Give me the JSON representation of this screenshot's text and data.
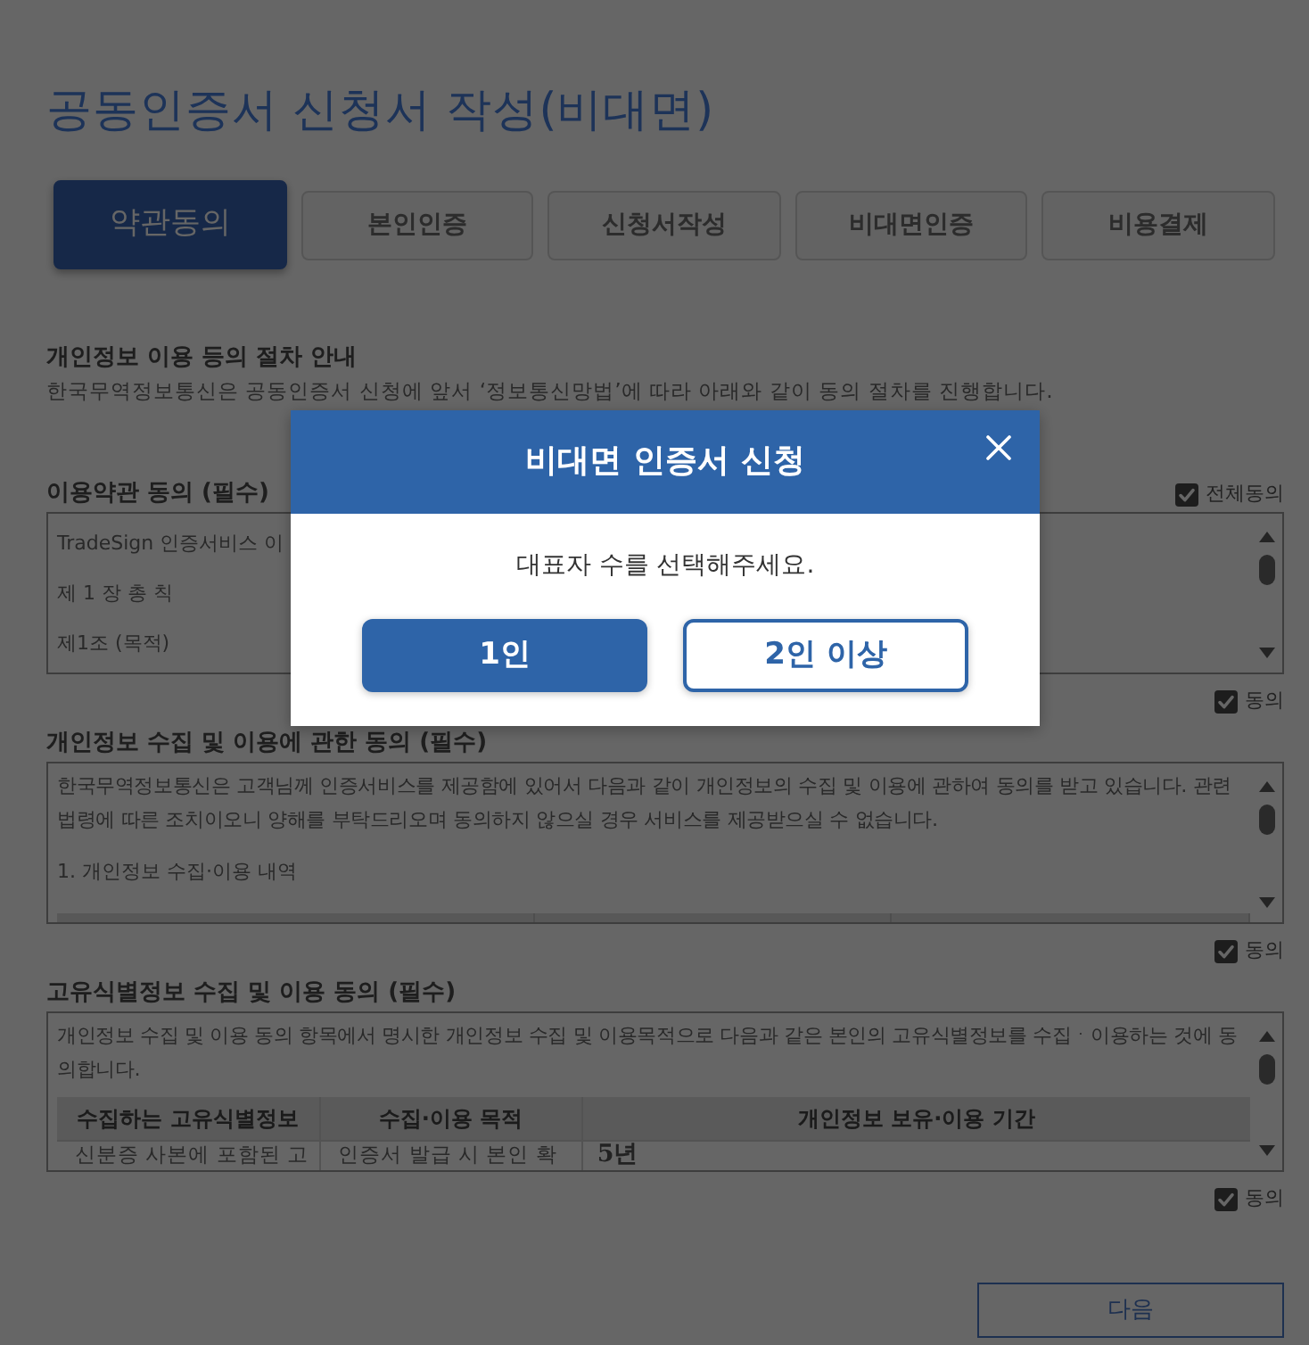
{
  "page": {
    "title": "공동인증서 신청서 작성(비대면)"
  },
  "steps": [
    {
      "label": "약관동의",
      "selected": true
    },
    {
      "label": "본인인증",
      "selected": false
    },
    {
      "label": "신청서작성",
      "selected": false
    },
    {
      "label": "비대면인증",
      "selected": false
    },
    {
      "label": "비용결제",
      "selected": false
    }
  ],
  "notice": {
    "heading": "개인정보 이용 등의 절차 안내",
    "text": "한국무역정보통신은 공동인증서 신청에 앞서 ‘정보통신망법’에 따라 아래와 같이 동의 절차를 진행합니다."
  },
  "agree_all": {
    "label": "전체동의",
    "checked": true
  },
  "sections": [
    {
      "heading": "이용약관 동의 (필수)",
      "content": [
        {
          "kind": "line",
          "text": "TradeSign 인증서비스 이"
        },
        {
          "kind": "line",
          "text": "제 1 장 총 칙"
        },
        {
          "kind": "line",
          "text": "제1조 (목적)"
        }
      ],
      "agree": {
        "label": "동의",
        "checked": true
      }
    },
    {
      "heading": "개인정보 수집 및 이용에 관한 동의 (필수)",
      "content": [
        {
          "kind": "paragraph",
          "text": "한국무역정보통신은 고객님께 인증서비스를 제공함에 있어서 다음과 같이 개인정보의 수집 및 이용에 관하여 동의를 받고 있습니다. 관련 법령에 따른 조치이오니 양해를 부탁드리오며 동의하지 않으실 경우 서비스를 제공받으실 수 없습니다."
        },
        {
          "kind": "line",
          "text": "1. 개인정보 수집·이용 내역"
        },
        {
          "kind": "table_edge"
        }
      ],
      "agree": {
        "label": "동의",
        "checked": true
      }
    },
    {
      "heading": "고유식별정보 수집 및 이용 동의 (필수)",
      "content": [
        {
          "kind": "paragraph",
          "text": "개인정보 수집 및 이용 동의 항목에서 명시한 개인정보 수집 및 이용목적으로 다음과 같은 본인의 고유식별정보를 수집ㆍ이용하는 것에 동의합니다."
        },
        {
          "kind": "table",
          "columns": [
            "수집하는 고유식별정보",
            "수집·이용 목적",
            "개인정보 보유·이용 기간"
          ],
          "rows": [
            [
              "신분증 사본에 포함된 고",
              "인증서 발급 시 본인 확",
              "5년"
            ]
          ]
        }
      ],
      "agree": {
        "label": "동의",
        "checked": true
      }
    }
  ],
  "next_button": {
    "label": "다음"
  },
  "dialog": {
    "title": "비대면 인증서 신청",
    "message": "대표자 수를 선택해주세요.",
    "buttons": [
      {
        "label": "1인",
        "kind": "filled"
      },
      {
        "label": "2인 이상",
        "kind": "outline"
      }
    ]
  }
}
